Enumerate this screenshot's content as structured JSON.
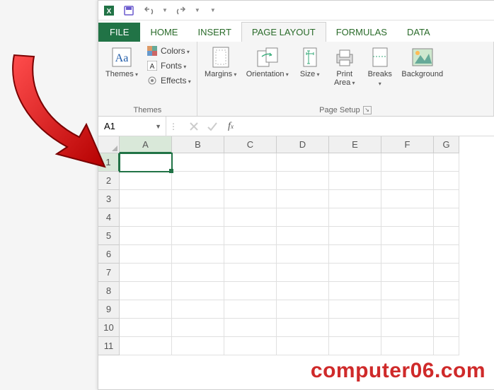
{
  "titlebar": {
    "app": "Excel"
  },
  "tabs": {
    "file": "FILE",
    "items": [
      "HOME",
      "INSERT",
      "PAGE LAYOUT",
      "FORMULAS",
      "DATA"
    ],
    "active_index": 2
  },
  "ribbon": {
    "themes_group": "Themes",
    "themes_btn": "Themes",
    "colors": "Colors",
    "fonts": "Fonts",
    "effects": "Effects",
    "pagesetup_group": "Page Setup",
    "margins": "Margins",
    "orientation": "Orientation",
    "size": "Size",
    "print_area": "Print\nArea",
    "breaks": "Breaks",
    "background": "Background"
  },
  "formula_bar": {
    "name_box": "A1",
    "formula": ""
  },
  "grid": {
    "columns": [
      "A",
      "B",
      "C",
      "D",
      "E",
      "F",
      "G"
    ],
    "rows": [
      1,
      2,
      3,
      4,
      5,
      6,
      7,
      8,
      9,
      10,
      11
    ],
    "active_cell": "A1"
  },
  "watermark": "computer06.com"
}
